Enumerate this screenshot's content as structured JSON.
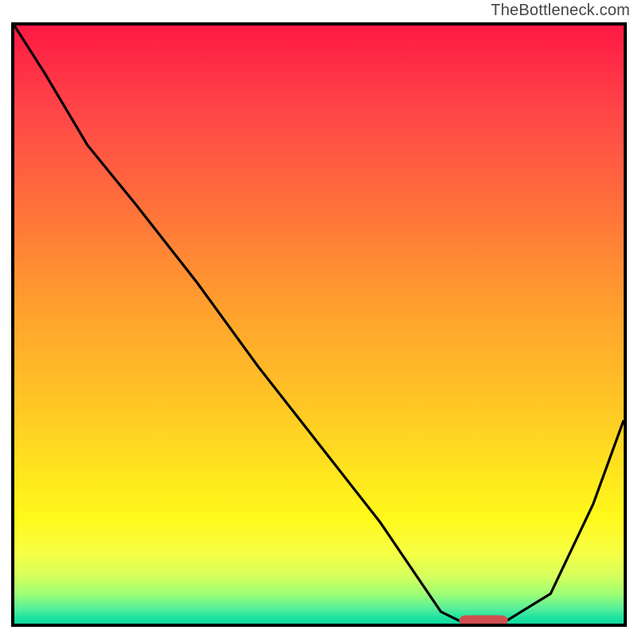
{
  "watermark": "TheBottleneck.com",
  "colors": {
    "gradient_top": "#ff1a44",
    "gradient_mid": "#ffc326",
    "gradient_bottom": "#10d9a3",
    "curve": "#000000",
    "marker": "#d05050",
    "frame": "#000000"
  },
  "chart_data": {
    "type": "line",
    "title": "",
    "xlabel": "",
    "ylabel": "",
    "xlim": [
      0,
      100
    ],
    "ylim": [
      0,
      100
    ],
    "grid": false,
    "legend": false,
    "background": "heatmap-gradient red→green",
    "x": [
      0,
      5,
      12,
      20,
      30,
      40,
      50,
      60,
      66,
      70,
      74,
      80,
      88,
      95,
      100
    ],
    "y": [
      100,
      92,
      80,
      70,
      57,
      43,
      30,
      17,
      8,
      2,
      0,
      0,
      5,
      20,
      34
    ],
    "min_marker": {
      "x_start": 73,
      "x_end": 81,
      "y": 0.5
    }
  }
}
